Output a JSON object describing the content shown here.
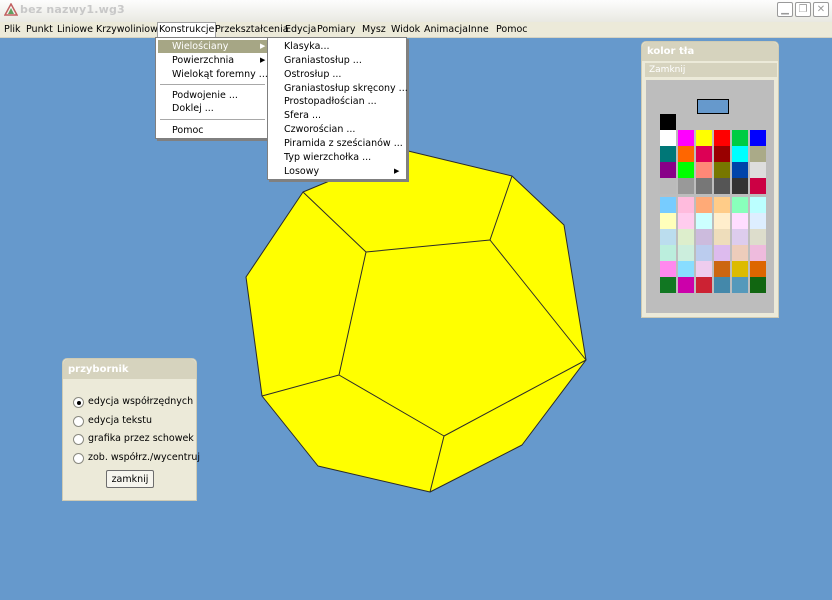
{
  "window": {
    "title": "bez nazwy1.wg3"
  },
  "menubar": {
    "items": [
      "Plik",
      "Punkt",
      "Liniowe",
      "Krzywoliniowe",
      "Konstrukcje",
      "Przekształcenia",
      "Edycja",
      "Pomiary",
      "Mysz",
      "Widok",
      "Animacja",
      "Inne",
      "Pomoc"
    ],
    "open_item": "Konstrukcje"
  },
  "konstrukcje_menu": {
    "items": [
      "Wielościany",
      "Powierzchnia",
      "Wielokąt foremny ...",
      "Podwojenie ...",
      "Doklej ...",
      "Pomoc"
    ],
    "highlighted": "Wielościany"
  },
  "wielosciany_menu": {
    "items": [
      "Klasyka...",
      "Graniastosłup ...",
      "Ostrosłup ...",
      "Graniastosłup skręcony ...",
      "Prostopadłościan ...",
      "Sfera ...",
      "Czworościan ...",
      "Piramida z sześcianów ...",
      "Typ wierzchołka ...",
      "Losowy"
    ]
  },
  "color_panel": {
    "title": "kolor tła",
    "close_label": "Zamknij",
    "current_color": "#6699cc",
    "palette": [
      [
        "#000000"
      ],
      [
        "#ffffff",
        "#ff00ff",
        "#ffff00",
        "#ff0000",
        "#00cc44",
        "#0000ff"
      ],
      [
        "#007777",
        "#ff6600",
        "#dd0055",
        "#990000",
        "#00ffff",
        "#aaaa88"
      ],
      [
        "#880088",
        "#00ff00",
        "#ff8877",
        "#777700",
        "#0044aa",
        "#dddddd"
      ],
      [
        "#bbbbbb",
        "#999999",
        "#777777",
        "#555555",
        "#333333",
        "#cc0044"
      ],
      [
        "#77ccff",
        "#ffbbdd",
        "#ffaa77",
        "#ffcc88",
        "#88ffbb",
        "#bbffff"
      ],
      [
        "#ffffbb",
        "#ffccee",
        "#ccffff",
        "#ffeecc",
        "#ffddff",
        "#ddeeff"
      ],
      [
        "#bbddee",
        "#ddeecc",
        "#ccbbdd",
        "#eeddbb",
        "#ddccee",
        "#ddddcc"
      ],
      [
        "#bbeedd",
        "#cceedd",
        "#bbccee",
        "#ddbbee",
        "#eeccbb",
        "#eebbdd"
      ],
      [
        "#ff88ee",
        "#88ddff",
        "#eeccee",
        "#cc6611",
        "#ddbb00",
        "#dd6600"
      ],
      [
        "#117722",
        "#cc00aa",
        "#cc2233",
        "#4488aa",
        "#5599bb",
        "#116611"
      ]
    ]
  },
  "toolbox": {
    "title": "przybornik",
    "options": [
      "edycja współrzędnych",
      "edycja tekstu",
      "grafika przez schowek",
      "zob. współrz./wycentruj"
    ],
    "selected_index": 0,
    "close_label": "zamknij"
  },
  "colors": {
    "desktop": "#6699cc",
    "polyhedron_fill": "#ffff00",
    "menu_highlight": "#a6a685"
  }
}
